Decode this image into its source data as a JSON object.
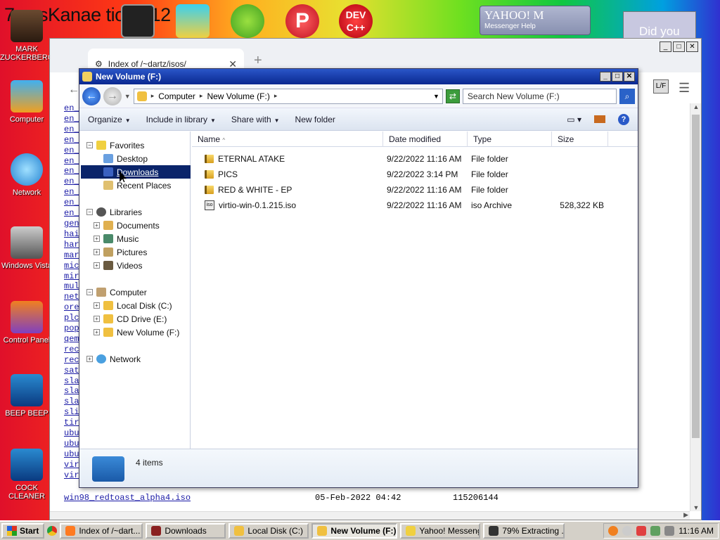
{
  "desktop": {
    "title": "7 ossKanae tion 012",
    "icons": [
      {
        "label": "MARK ZUCKERBERG",
        "icon": "person-icon"
      },
      {
        "label": "Computer",
        "icon": "computer-icon"
      },
      {
        "label": "Network",
        "icon": "network-icon"
      },
      {
        "label": "Windows Vista",
        "icon": "recycle-bin-icon"
      },
      {
        "label": "Control Panel",
        "icon": "control-panel-icon"
      },
      {
        "label": "BEEP BEEP",
        "icon": "book-icon"
      },
      {
        "label": "COCK CLEANER",
        "icon": "book-icon"
      }
    ],
    "top_icons": [
      "cmd-icon",
      "stack-icon",
      "angry-bird-icon",
      "p-app-icon",
      "devcpp-icon"
    ],
    "devcpp_label": "DEV C++",
    "yahoo": {
      "logo": "YAHOO! M",
      "subtitle": "Messenger    Help"
    },
    "did_you": "Did you"
  },
  "browser": {
    "tab_title": "Index of /~dartz/isos/",
    "new_tab": "+",
    "links": [
      "en_",
      "en_",
      "en_",
      "en_",
      "en_",
      "en_",
      "en_",
      "en_",
      "en_",
      "en_",
      "en_",
      "gen",
      "hai",
      "har",
      "mar",
      "mic",
      "mir",
      "mul",
      "net",
      "ore",
      "plc",
      "pop",
      "qem",
      "rec",
      "rec",
      "sat",
      "sla",
      "sla",
      "sla",
      "sli",
      "tir",
      "ubu",
      "ubu",
      "ubu",
      "vir",
      "vir"
    ],
    "last_row": {
      "file": "win98_redtoast_alpha4.iso",
      "date": "05-Feb-2022 04:42",
      "size": "115206144"
    },
    "lf_label": "L/F"
  },
  "explorer": {
    "title": "New Volume (F:)",
    "address": [
      "Computer",
      "New Volume (F:)"
    ],
    "search_placeholder": "Search New Volume (F:)",
    "toolbar": {
      "organize": "Organize",
      "include_library": "Include in library",
      "share_with": "Share with",
      "new_folder": "New folder"
    },
    "nav": {
      "favorites": "Favorites",
      "desktop": "Desktop",
      "downloads": "Downloads",
      "recent": "Recent Places",
      "libraries": "Libraries",
      "documents": "Documents",
      "music": "Music",
      "pictures": "Pictures",
      "videos": "Videos",
      "computer": "Computer",
      "local_disk": "Local Disk (C:)",
      "cd_drive": "CD Drive (E:)",
      "new_volume": "New Volume (F:)",
      "network": "Network"
    },
    "columns": {
      "name": "Name",
      "date": "Date modified",
      "type": "Type",
      "size": "Size"
    },
    "files": [
      {
        "name": "ETERNAL ATAKE",
        "date": "9/22/2022 11:16 AM",
        "type": "File folder",
        "size": ""
      },
      {
        "name": "PICS",
        "date": "9/22/2022 3:14 PM",
        "type": "File folder",
        "size": ""
      },
      {
        "name": "RED & WHITE - EP",
        "date": "9/22/2022 11:16 AM",
        "type": "File folder",
        "size": ""
      },
      {
        "name": "virtio-win-0.1.215.iso",
        "date": "9/22/2022 11:16 AM",
        "type": "iso Archive",
        "size": "528,322 KB"
      }
    ],
    "item_count": "4 items"
  },
  "taskbar": {
    "start": "Start",
    "tasks": [
      {
        "label": "Index of /~dart...",
        "active": false
      },
      {
        "label": "Downloads",
        "active": false
      },
      {
        "label": "Local Disk (C:)",
        "active": false
      },
      {
        "label": "New Volume (F:)",
        "active": true
      },
      {
        "label": "Yahoo! Messenger",
        "active": false
      },
      {
        "label": "79% Extracting ...",
        "active": false
      }
    ],
    "clock": "11:16 AM"
  },
  "colors": {
    "title_bar": "#0a2890",
    "selection": "#0a246a",
    "link": "#1a1aa6"
  }
}
